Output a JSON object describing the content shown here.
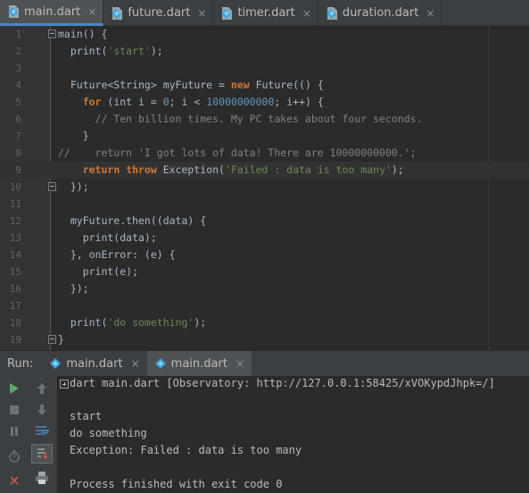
{
  "editor_tabs": [
    {
      "label": "main.dart",
      "active": true
    },
    {
      "label": "future.dart",
      "active": false
    },
    {
      "label": "timer.dart",
      "active": false
    },
    {
      "label": "duration.dart",
      "active": false
    }
  ],
  "close_glyph": "×",
  "code_lines": [
    {
      "n": "1",
      "text": "main() {"
    },
    {
      "n": "2",
      "text": "  print('start');"
    },
    {
      "n": "3",
      "text": ""
    },
    {
      "n": "4",
      "text": "  Future<String> myFuture = new Future(() {"
    },
    {
      "n": "5",
      "text": "    for (int i = 0; i < 10000000000; i++) {"
    },
    {
      "n": "6",
      "text": "      // Ten billion times. My PC takes about four seconds."
    },
    {
      "n": "7",
      "text": "    }"
    },
    {
      "n": "8",
      "text": "//    return 'I got lots of data! There are 10000000000.';"
    },
    {
      "n": "9",
      "text": "    return throw Exception('Failed : data is too many');"
    },
    {
      "n": "10",
      "text": "  });"
    },
    {
      "n": "11",
      "text": ""
    },
    {
      "n": "12",
      "text": "  myFuture.then((data) {"
    },
    {
      "n": "13",
      "text": "    print(data);"
    },
    {
      "n": "14",
      "text": "  }, onError: (e) {"
    },
    {
      "n": "15",
      "text": "    print(e);"
    },
    {
      "n": "16",
      "text": "  });"
    },
    {
      "n": "17",
      "text": ""
    },
    {
      "n": "18",
      "text": "  print('do something');"
    },
    {
      "n": "19",
      "text": "}"
    }
  ],
  "run_panel": {
    "label": "Run:",
    "tabs": [
      {
        "label": "main.dart",
        "active": false
      },
      {
        "label": "main.dart",
        "active": true
      }
    ]
  },
  "console": {
    "command": "dart main.dart [Observatory: http://127.0.0.1:58425/xVOKypdJhpk=/]",
    "output": [
      "start",
      "do something",
      "Exception: Failed : data is too many"
    ],
    "exit": "Process finished with exit code 0"
  },
  "colors": {
    "keyword": "#cc7832",
    "string": "#6a8759",
    "number": "#6897bb",
    "comment": "#808080",
    "dart_icon": "#3d9fd8"
  }
}
